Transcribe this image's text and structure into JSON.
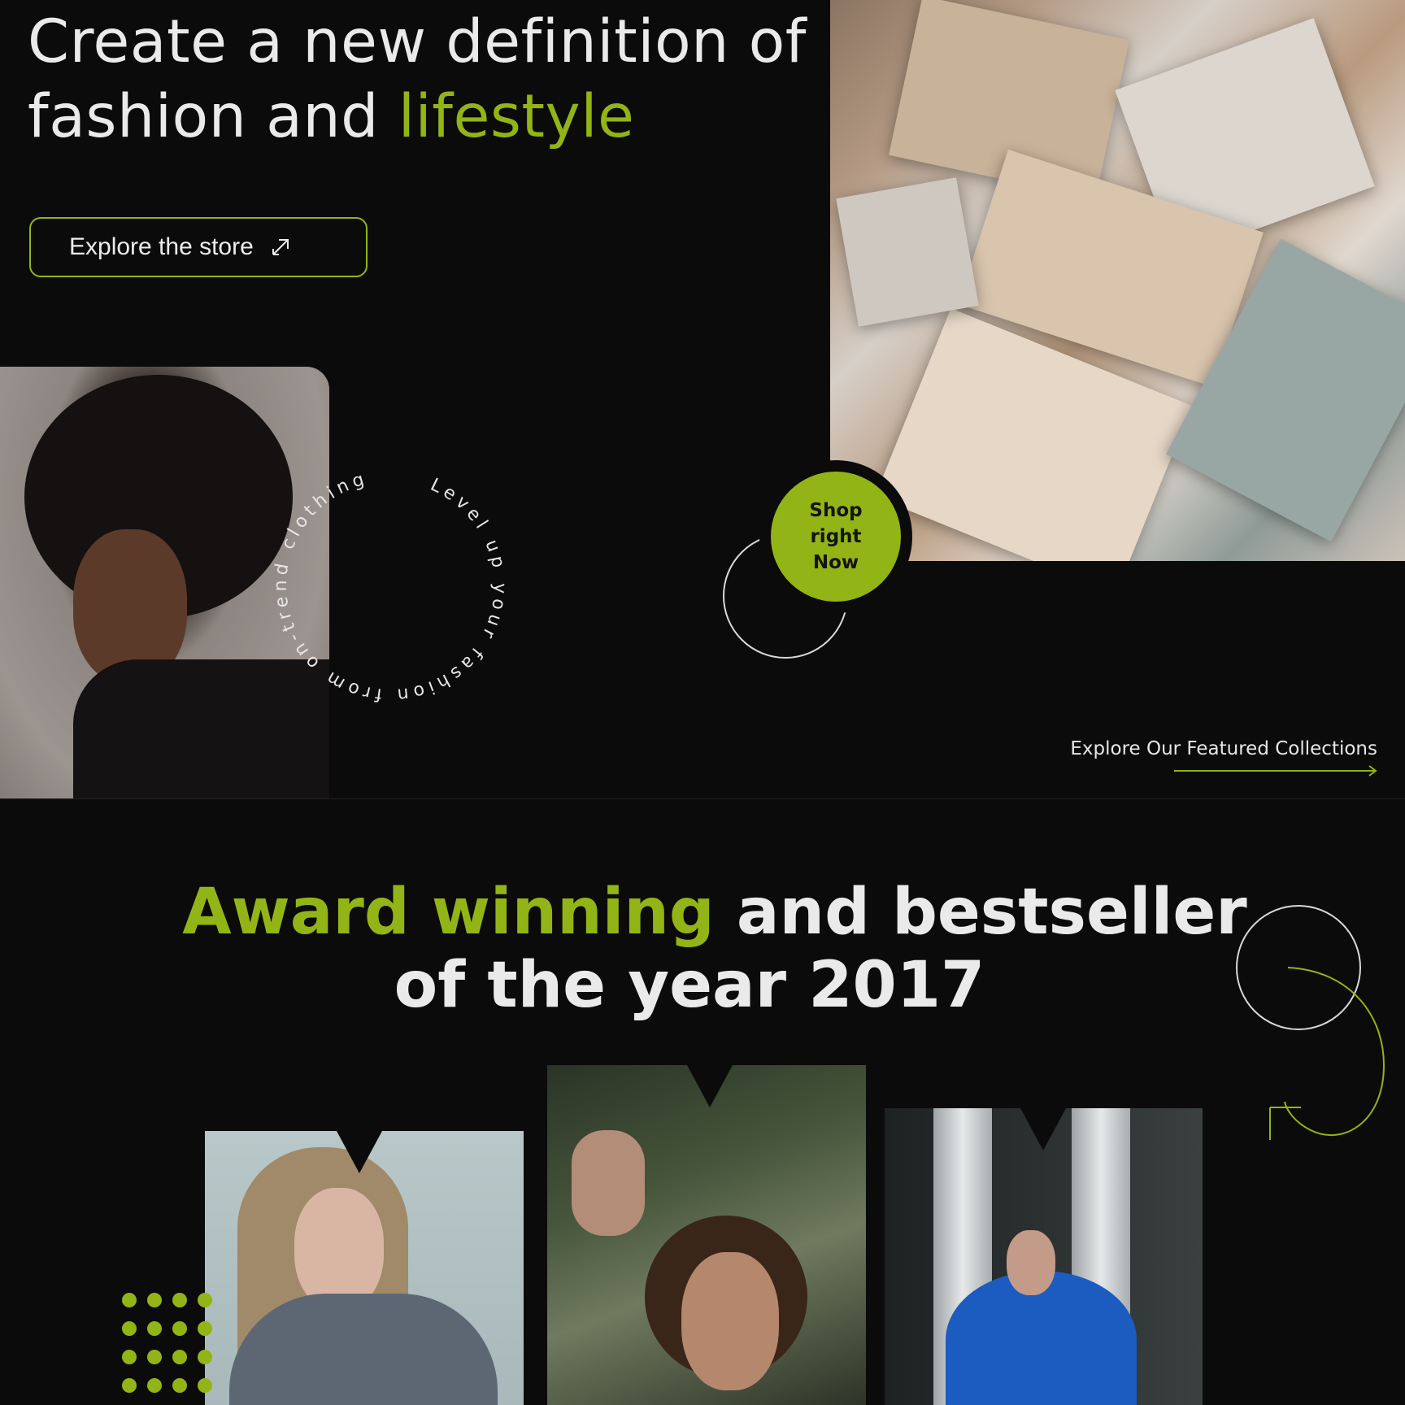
{
  "hero": {
    "title_part1": "Create a new definition of",
    "title_part2": "fashion and ",
    "title_accent": "lifestyle",
    "cta_label": "Explore the store"
  },
  "shop_badge": {
    "line1": "Shop",
    "line2": "right",
    "line3": "Now"
  },
  "circular_text": "Level up your fashion from on-trend clothing",
  "featured": {
    "label": "Explore Our Featured Collections"
  },
  "award": {
    "accent": "Award winning",
    "rest": " and bestseller",
    "line2": "of the year 2017"
  },
  "colors": {
    "accent": "#93b416",
    "background": "#0b0b0b",
    "text": "#eaeaea"
  }
}
